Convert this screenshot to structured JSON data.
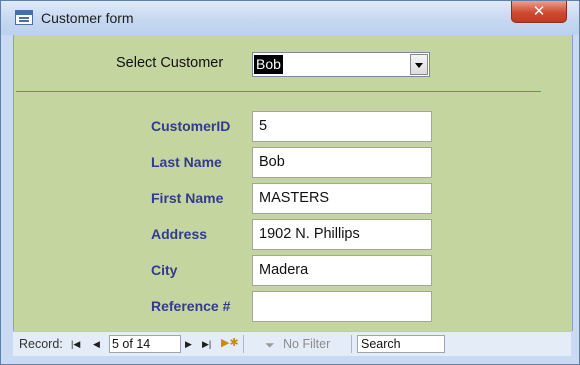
{
  "window": {
    "title": "Customer form",
    "close_glyph": "✕"
  },
  "selector": {
    "label": "Select Customer",
    "value": "Bob"
  },
  "fields": [
    {
      "label": "CustomerID",
      "value": "5"
    },
    {
      "label": "Last Name",
      "value": "Bob"
    },
    {
      "label": "First Name",
      "value": "MASTERS"
    },
    {
      "label": "Address",
      "value": "1902 N. Phillips"
    },
    {
      "label": "City",
      "value": "Madera"
    },
    {
      "label": "Reference #",
      "value": ""
    }
  ],
  "navigation": {
    "record_label": "Record:",
    "record_position": "5 of 14",
    "filter_label": "No Filter",
    "search_placeholder": "Search",
    "icons": [
      "first-record-icon",
      "previous-record-icon",
      "next-record-icon",
      "last-record-icon",
      "new-record-icon",
      "filter-icon"
    ]
  },
  "colors": {
    "form_background": "#c4d59f",
    "label_color": "#333a8f",
    "window_frame": "#c9daf2",
    "close_button": "#cf4a32"
  }
}
